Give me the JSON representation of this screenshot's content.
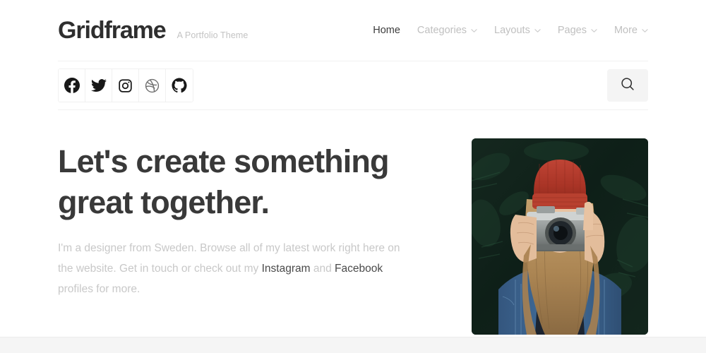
{
  "header": {
    "logo": "Gridframe",
    "tagline": "A Portfolio Theme",
    "nav": [
      {
        "label": "Home",
        "active": true,
        "has_chevron": false,
        "icon": ""
      },
      {
        "label": "Categories",
        "active": false,
        "has_chevron": true,
        "icon": "chevron-down-icon"
      },
      {
        "label": "Layouts",
        "active": false,
        "has_chevron": true,
        "icon": "chevron-down-icon"
      },
      {
        "label": "Pages",
        "active": false,
        "has_chevron": true,
        "icon": "chevron-down-icon"
      },
      {
        "label": "More",
        "active": false,
        "has_chevron": true,
        "icon": "chevron-down-icon"
      }
    ]
  },
  "social": {
    "items": [
      {
        "name": "facebook-icon",
        "label": "Facebook"
      },
      {
        "name": "twitter-icon",
        "label": "Twitter"
      },
      {
        "name": "instagram-icon",
        "label": "Instagram"
      },
      {
        "name": "dribbble-icon",
        "label": "Dribbble"
      },
      {
        "name": "github-icon",
        "label": "GitHub"
      }
    ]
  },
  "search": {
    "icon": "search-icon",
    "label": "Search"
  },
  "hero": {
    "title_line_1": "Let's create something",
    "title_line_2": "great together.",
    "paragraph_part_1": "I'm a designer from Sweden. Browse all of my latest work right here on the website. Get in touch or check out my ",
    "link_1": "Instagram",
    "paragraph_part_2": " and ",
    "link_2": "Facebook",
    "paragraph_part_3": " profiles for more.",
    "image_alt": "Woman in red beanie and denim jacket holding a vintage camera in front of dark green foliage"
  },
  "colors": {
    "heading": "#393939",
    "body_text": "#c8c8c8",
    "nav_inactive": "#c0c0c0",
    "nav_active": "#3c3c3c",
    "divider": "#f1f1f1",
    "search_bg": "#f4f4f4",
    "footer_strip": "#f5f5f5",
    "beanie_red": "#b03a2e",
    "denim_blue": "#3d6590",
    "foliage_green": "#12241d",
    "hair_blonde": "#b08a5c"
  }
}
